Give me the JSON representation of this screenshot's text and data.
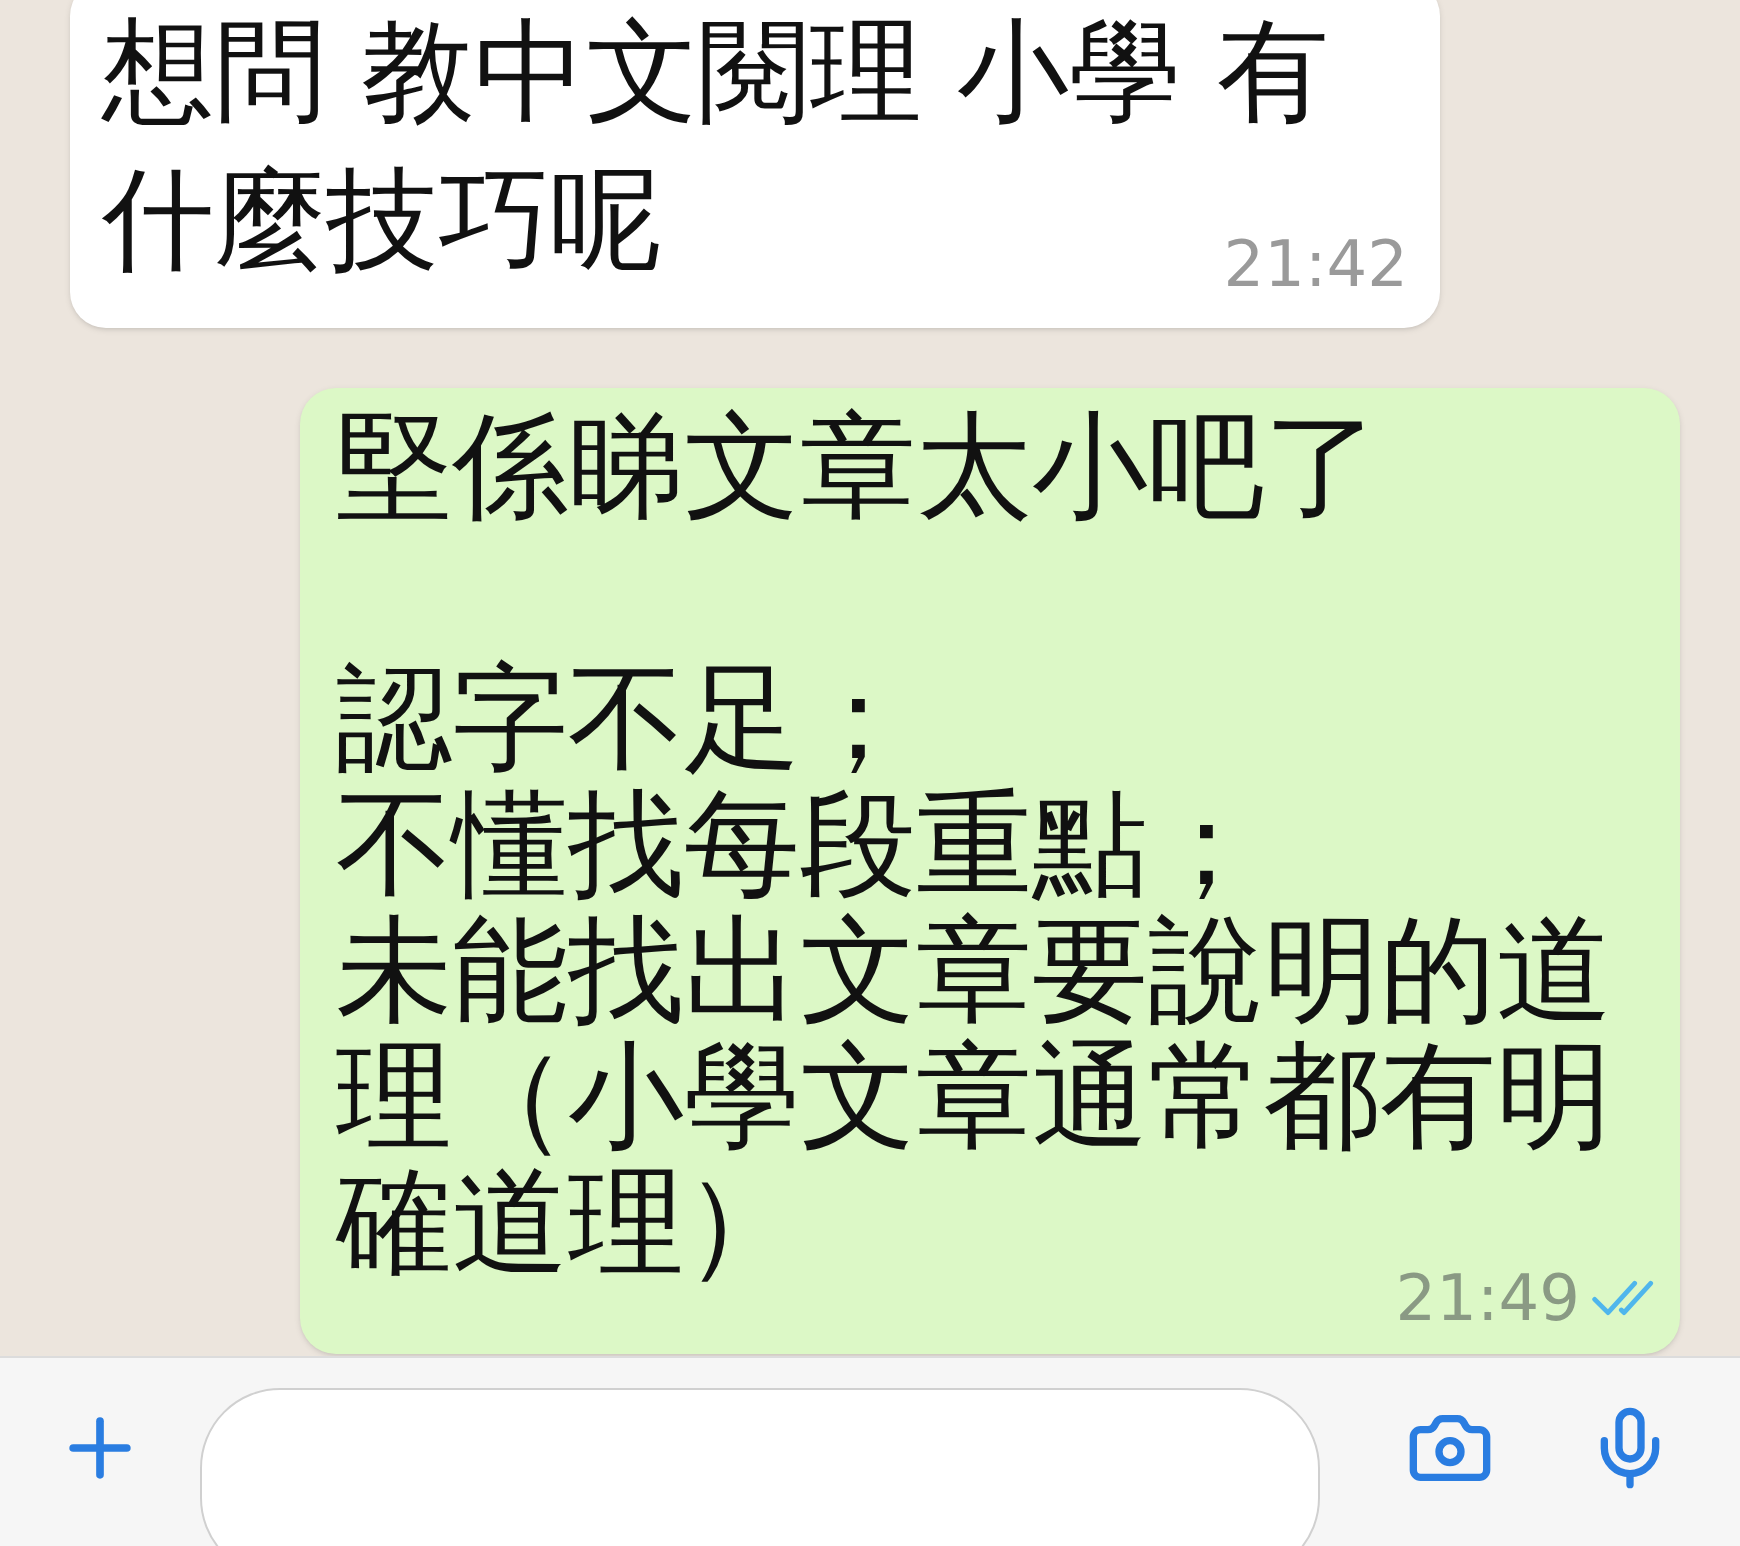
{
  "messages": [
    {
      "kind": "incoming",
      "paragraphs": [
        [
          "想問 教中文閱理 小學 有",
          "什麼技巧呢"
        ]
      ],
      "time": "21:42"
    },
    {
      "kind": "outgoing",
      "paragraphs": [
        [
          "堅係睇文章太小吧了"
        ],
        [
          "認字不足；",
          "不懂找每段重點；",
          "未能找出文章要說明的道理（小學文章通常都有明確道理）"
        ]
      ],
      "time": "21:49",
      "read": true
    }
  ]
}
